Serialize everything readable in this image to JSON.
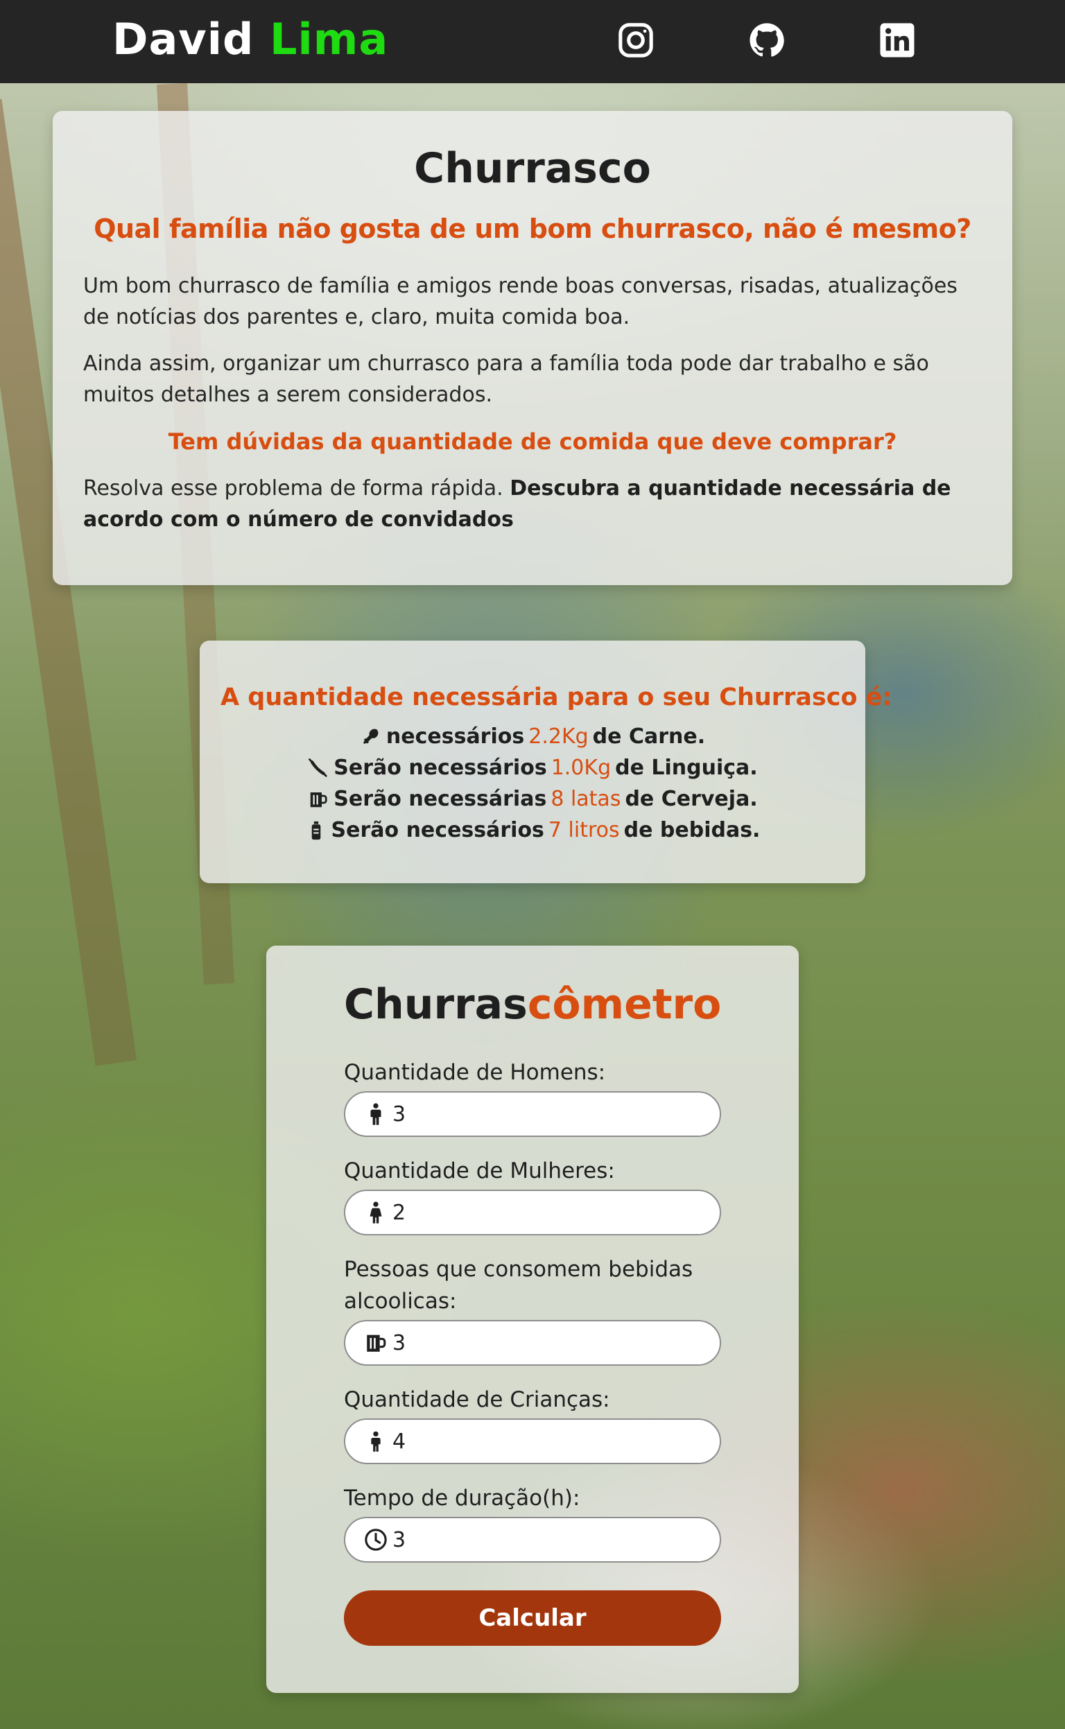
{
  "header": {
    "logo_first": "David",
    "logo_second": "Lima",
    "social": [
      "instagram-icon",
      "github-icon",
      "linkedin-icon"
    ]
  },
  "intro": {
    "title": "Churrasco",
    "subtitle": "Qual família não gosta de um bom churrasco, não é mesmo?",
    "paragraph1": "Um bom churrasco de família e amigos rende boas conversas, risadas, atualizações de notícias dos parentes e, claro, muita comida boa.",
    "paragraph2": "Ainda assim, organizar um churrasco para a família toda pode dar trabalho e são muitos detalhes a serem considerados.",
    "question": "Tem dúvidas da quantidade de comida que deve comprar?",
    "resolve_plain": "Resolva esse problema de forma rápida.",
    "resolve_bold": "Descubra a quantidade necessária de acordo com o número de convidados"
  },
  "results": {
    "title": "A quantidade necessária para o seu Churrasco é:",
    "lines": [
      {
        "icon": "drumstick-icon",
        "prefix": "necessários",
        "value": "2.2Kg",
        "suffix": "de Carne."
      },
      {
        "icon": "sausage-icon",
        "prefix": "Serão necessários",
        "value": "1.0Kg",
        "suffix": "de Linguiça."
      },
      {
        "icon": "beer-mug-icon",
        "prefix": "Serão necessárias",
        "value": "8 latas",
        "suffix": "de Cerveja."
      },
      {
        "icon": "bottle-icon",
        "prefix": "Serão necessários",
        "value": "7 litros",
        "suffix": "de bebidas."
      }
    ]
  },
  "calculator": {
    "title_first": "Churras",
    "title_second": "cômetro",
    "fields": [
      {
        "label": "Quantidade de Homens:",
        "icon": "man-icon",
        "value": "3"
      },
      {
        "label": "Quantidade de Mulheres:",
        "icon": "woman-icon",
        "value": "2"
      },
      {
        "label": "Pessoas que consomem bebidas alcoolicas:",
        "icon": "beer-mug-icon",
        "value": "3"
      },
      {
        "label": "Quantidade de Crianças:",
        "icon": "child-icon",
        "value": "4"
      },
      {
        "label": "Tempo de duração(h):",
        "icon": "clock-icon",
        "value": "3"
      }
    ],
    "button_label": "Calcular",
    "accent_color": "#d84d10",
    "button_color": "#a3360d"
  }
}
